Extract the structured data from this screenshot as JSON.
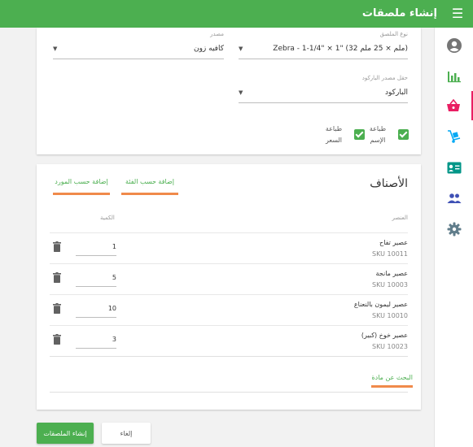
{
  "app": {
    "title": "إنشاء ملصقات",
    "menu_icon": "hamburger-menu-icon"
  },
  "sidebar": {
    "accent": "#e91e63",
    "items": [
      {
        "icon": "user-circle-icon"
      },
      {
        "icon": "bar-chart-icon"
      },
      {
        "icon": "basket-icon",
        "active": true
      },
      {
        "icon": "hand-truck-icon"
      },
      {
        "icon": "contact-card-icon"
      },
      {
        "icon": "people-icon"
      },
      {
        "icon": "gear-icon"
      }
    ]
  },
  "settings": {
    "label_type": {
      "label": "نوع الملصق",
      "value": "Zebra - 1-1/4\" × 1\" (32 ملم × 25 ملم)"
    },
    "supplier": {
      "label": "مصدر",
      "value": "كافيه زون"
    },
    "barcode_source": {
      "label": "حقل مصدر الباركود",
      "value": "الباركود"
    },
    "print_name": {
      "label_line1": "طباعة",
      "label_line2": "الإسم",
      "checked": true
    },
    "print_price": {
      "label_line1": "طباعة",
      "label_line2": "السعر",
      "checked": true
    }
  },
  "items": {
    "title": "الأصناف",
    "tabs": [
      {
        "label": "إضافة حسب الفئة"
      },
      {
        "label": "إضافة حسب المورد"
      }
    ],
    "columns": {
      "item": "العنصر",
      "quantity": "الكمية"
    },
    "rows": [
      {
        "name": "عصير تفاح",
        "sku": "SKU 10011",
        "qty": "1"
      },
      {
        "name": "عصير مانجة",
        "sku": "SKU 10003",
        "qty": "5"
      },
      {
        "name": "عصير ليمون بالنعناع",
        "sku": "SKU 10010",
        "qty": "10"
      },
      {
        "name": "عصير خوخ (كبير)",
        "sku": "SKU 10023",
        "qty": "3"
      }
    ],
    "search_label": "البحث عن مادة"
  },
  "actions": {
    "create": "إنشاء الملصقات",
    "cancel": "إلغاء"
  },
  "colors": {
    "primary": "#4caf50",
    "tab_underline": "#f08a4b"
  }
}
